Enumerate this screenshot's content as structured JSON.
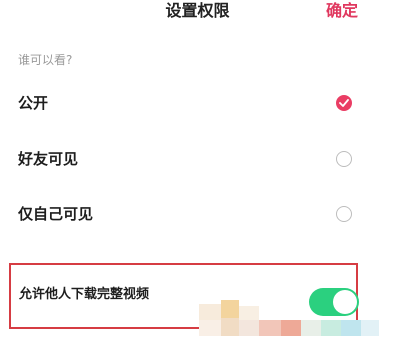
{
  "header": {
    "title": "设置权限",
    "confirm_label": "确定"
  },
  "visibility": {
    "section_label": "谁可以看?",
    "options": [
      {
        "label": "公开",
        "selected": true
      },
      {
        "label": "好友可见",
        "selected": false
      },
      {
        "label": "仅自己可见",
        "selected": false
      }
    ]
  },
  "download": {
    "label": "允许他人下载完整视频",
    "enabled": true
  },
  "colors": {
    "accent": "#e0385f",
    "toggle_on": "#2bd07f",
    "highlight_border": "#d63c43"
  }
}
